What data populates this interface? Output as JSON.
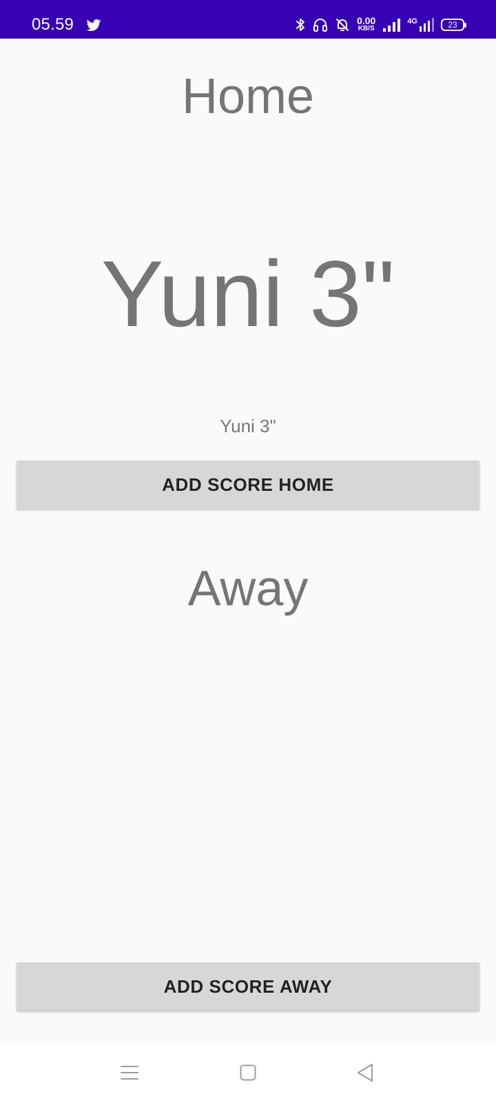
{
  "status_bar": {
    "time": "05.59",
    "network_speed_value": "0.00",
    "network_speed_unit": "KB/S",
    "network_type": "4G",
    "battery_level": "23",
    "background_color": "#3700b3",
    "icons": [
      "twitter-icon",
      "bluetooth-icon",
      "headphones-icon",
      "notifications-off-icon",
      "signal-icon",
      "signal-4g-icon",
      "battery-icon"
    ]
  },
  "home": {
    "label": "Home",
    "score_large": "Yuni 3\"",
    "score_small": "Yuni 3\"",
    "button_label": "ADD SCORE HOME"
  },
  "away": {
    "label": "Away",
    "button_label": "ADD SCORE AWAY"
  },
  "nav_bar": {
    "icons": [
      "menu-icon",
      "home-square-icon",
      "back-triangle-icon"
    ]
  },
  "colors": {
    "text_gray": "#757575",
    "button_bg": "#d6d7d7",
    "button_text": "#222222",
    "page_bg": "#fafafa"
  }
}
